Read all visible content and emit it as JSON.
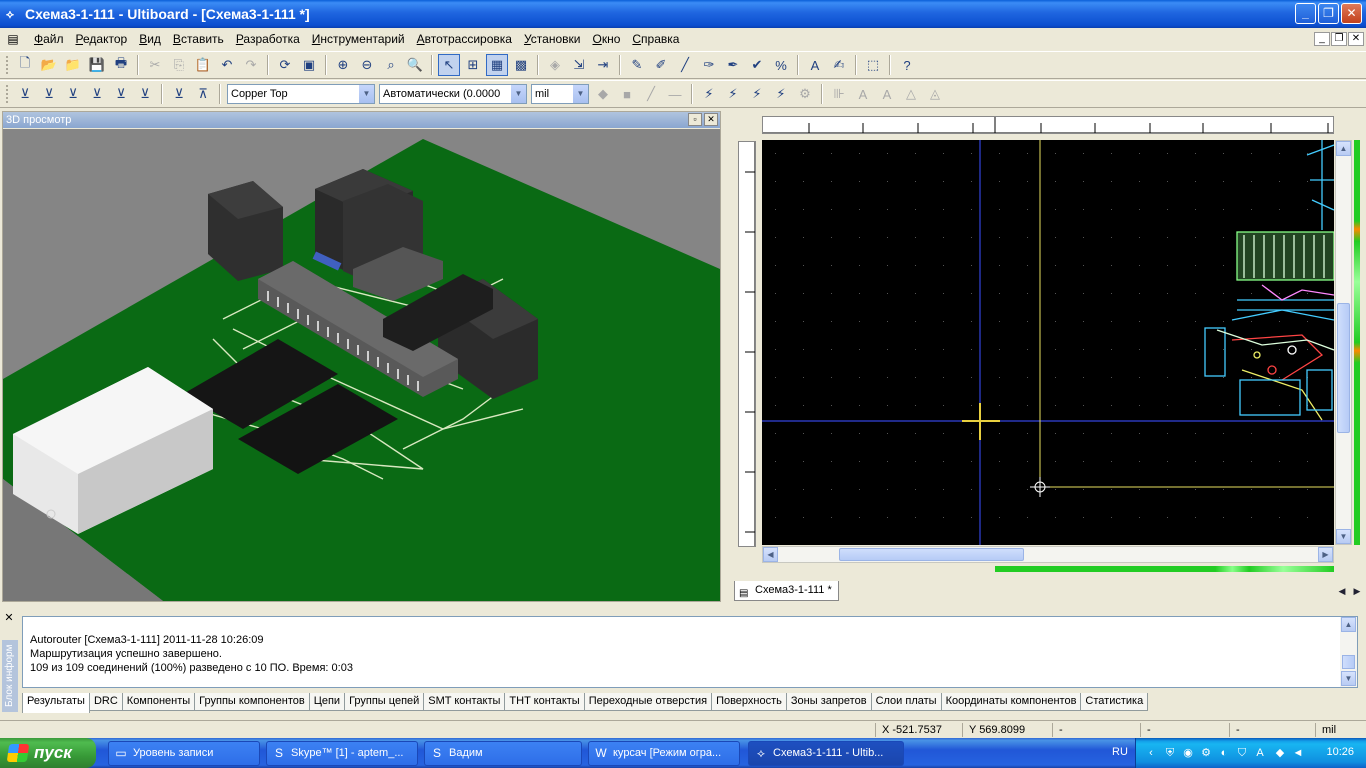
{
  "window": {
    "title": "Схема3-1-111 - Ultiboard - [Схема3-1-111 *]",
    "minimize": "_",
    "maximize": "❐",
    "close": "✕"
  },
  "menu": {
    "items": [
      "Файл",
      "Редактор",
      "Вид",
      "Вставить",
      "Разработка",
      "Инструментарий",
      "Автотрассировка",
      "Установки",
      "Окно",
      "Справка"
    ],
    "mdi_min": "_",
    "mdi_restore": "❐",
    "mdi_close": "✕"
  },
  "toolbar2": {
    "layer_select": "Copper Top",
    "width_select": "Автоматически (0.0000",
    "units_select": "mil"
  },
  "panel3d": {
    "title": "3D просмотр",
    "pin_btn": "▫",
    "close_btn": "✕"
  },
  "doc_tab": {
    "label": "Схема3-1-111 *"
  },
  "info": {
    "side_label": "Блок информ",
    "close_btn": "✕",
    "log_lines": [
      "Autorouter [Схема3-1-111]  2011-11-28 10:26:09",
      "Маршрутизация успешно завершено.",
      "109 из 109 соединений (100%) разведено с 10 ПО.  Время: 0:03"
    ],
    "tabs": [
      "Результаты",
      "DRC",
      "Компоненты",
      "Группы компонентов",
      "Цепи",
      "Группы цепей",
      "SMT контакты",
      "THT контакты",
      "Переходные отверстия",
      "Поверхность",
      "Зоны запретов",
      "Слои платы",
      "Координаты компонентов",
      "Статистика"
    ]
  },
  "status": {
    "x": "X -521.7537",
    "y": "Y 569.8099",
    "c1": "-",
    "c2": "-",
    "c3": "-",
    "units": "mil"
  },
  "taskbar": {
    "start": "пуск",
    "tasks": [
      "Уровень записи",
      "Skype™ [1] - aptem_...",
      "Вадим",
      "курсач [Режим огра...",
      "Схема3-1-111 - Ultib..."
    ],
    "lang": "RU",
    "clock": "10:26"
  }
}
